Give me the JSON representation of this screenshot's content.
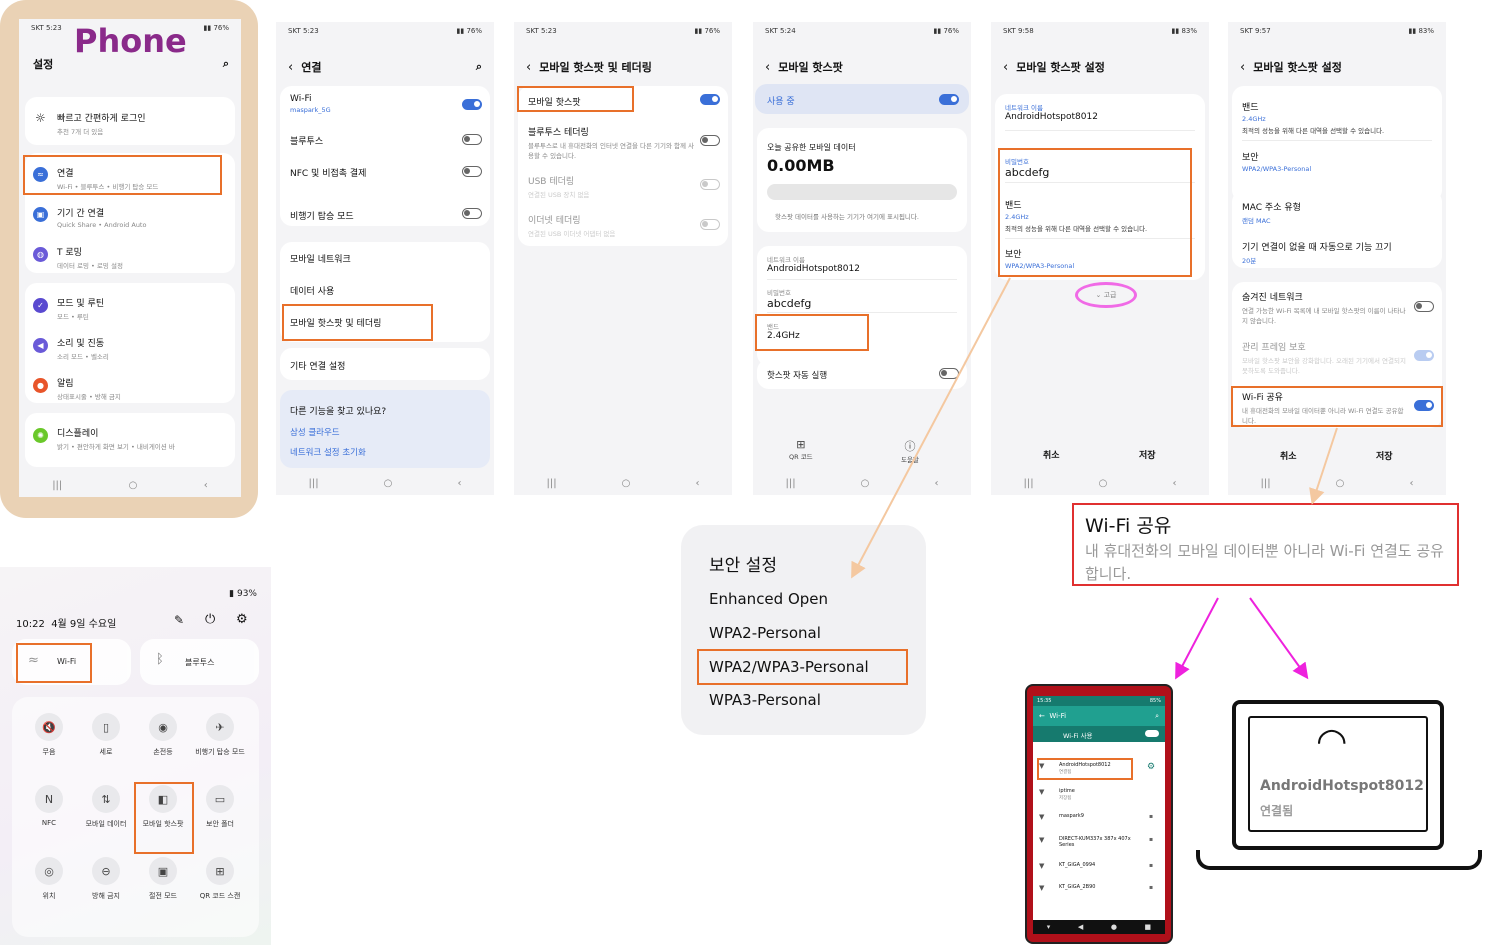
{
  "phone_label": "Phone",
  "s1": {
    "status": "SKT 5:23",
    "battery": "76%",
    "title": "설정",
    "items": [
      {
        "t": "빠르고 간편하게 로그인",
        "s": "추천 7개 더 있음"
      },
      {
        "t": "연결",
        "s": "Wi-Fi • 블루투스 • 비행기 탑승 모드"
      },
      {
        "t": "기기 간 연결",
        "s": "Quick Share • Android Auto"
      },
      {
        "t": "T 로밍",
        "s": "데이터 로밍 • 로밍 설정"
      },
      {
        "t": "모드 및 루틴",
        "s": "모드 • 루틴"
      },
      {
        "t": "소리 및 진동",
        "s": "소리 모드 • 벨소리"
      },
      {
        "t": "알림",
        "s": "상태표시줄 • 방해 금지"
      },
      {
        "t": "디스플레이",
        "s": "밝기 • 편안하게 화면 보기 • 내비게이션 바"
      }
    ]
  },
  "s2": {
    "status": "SKT 5:23",
    "battery": "76%",
    "title": "연결",
    "wifi": "Wi-Fi",
    "wifi_sub": "maspark_5G",
    "bt": "블루투스",
    "nfc": "NFC 및 비접촉 결제",
    "air": "비행기 탑승 모드",
    "mobile_net": "모바일 네트워크",
    "data": "데이터 사용",
    "hotspot": "모바일 핫스팟 및 테더링",
    "other": "기타 연결 설정",
    "looking": "다른 기능을 찾고 있나요?",
    "cloud": "삼성 클라우드",
    "reset": "네트워크 설정 초기화"
  },
  "s3": {
    "status": "SKT 5:23",
    "battery": "76%",
    "title": "모바일 핫스팟 및 테더링",
    "mh": "모바일 핫스팟",
    "bt": "블루투스 테더링",
    "bt_sub": "블루투스로 내 휴대전화의 인터넷 연결을 다른 기기와 함께 사용할 수 있습니다.",
    "usb": "USB 테더링",
    "usb_sub": "연결된 USB 장치 없음",
    "eth": "이더넷 테더링",
    "eth_sub": "연결된 USB 이더넷 어댑터 없음"
  },
  "s4": {
    "status": "SKT 5:24",
    "battery": "76%",
    "title": "모바일 핫스팟",
    "in_use": "사용 중",
    "today": "오늘 공유한 모바일 데이터",
    "mb": "0.00MB",
    "note": "핫스팟 데이터를 사용하는 기기가 여기에 표시됩니다.",
    "name_l": "네트워크 이름",
    "name": "AndroidHotspot8012",
    "pw_l": "비밀번호",
    "pw": "abcdefg",
    "band_l": "밴드",
    "band": "2.4GHz",
    "auto": "핫스팟 자동 실행",
    "qr": "QR 코드",
    "help": "도움말"
  },
  "s5": {
    "status": "SKT 9:58",
    "battery": "83%",
    "title": "모바일 핫스팟 설정",
    "name_l": "네트워크 이름",
    "name": "AndroidHotspot8012",
    "pw_l": "비밀번호",
    "pw": "abcdefg",
    "band_l": "밴드",
    "band": "2.4GHz",
    "band_s": "최적의 성능을 위해 다른 대역을 선택할 수 있습니다.",
    "sec_l": "보안",
    "sec": "WPA2/WPA3-Personal",
    "adv": "고급",
    "cancel": "취소",
    "save": "저장"
  },
  "s6": {
    "status": "SKT 9:57",
    "battery": "83%",
    "title": "모바일 핫스팟 설정",
    "band_l": "밴드",
    "band": "2.4GHz",
    "band_s": "최적의 성능을 위해 다른 대역을 선택할 수 있습니다.",
    "sec_l": "보안",
    "sec": "WPA2/WPA3-Personal",
    "mac_l": "MAC 주소 유형",
    "mac": "랜덤 MAC",
    "off_l": "기기 연결이 없을 때 자동으로 기능 끄기",
    "off": "20분",
    "hidden": "숨겨진 네트워크",
    "hidden_s": "연결 가능한 Wi-Fi 목록에 내 모바일 핫스팟의 이름이 나타나지 않습니다.",
    "pmf": "관리 프레임 보호",
    "pmf_s": "모바일 핫스팟 보안을 강화합니다. 오래된 기기에서 연결되지 못하도록 도와줍니다.",
    "share": "Wi-Fi 공유",
    "share_s": "내 휴대전화의 모바일 데이터뿐 아니라 Wi-Fi 연결도 공유합니다.",
    "cancel": "취소",
    "save": "저장"
  },
  "qp": {
    "battery": "93%",
    "clock": "10:22",
    "date": "4월 9일 수요일",
    "wifi": "Wi-Fi",
    "bt": "블루투스",
    "tiles": [
      "무음",
      "세로",
      "손전등",
      "비행기 탑승 모드",
      "NFC",
      "모바일 데이터",
      "모바일 핫스팟",
      "보안 폴더",
      "위치",
      "방해 금지",
      "절전 모드",
      "QR 코드 스캔"
    ]
  },
  "security": {
    "title": "보안 설정",
    "options": [
      "Enhanced Open",
      "WPA2-Personal",
      "WPA2/WPA3-Personal",
      "WPA3-Personal"
    ]
  },
  "callout": {
    "title": "Wi-Fi 공유",
    "desc": "내 휴대전화의 모바일 데이터뿐 아니라 Wi-Fi 연결도 공유합니다."
  },
  "client": {
    "status": "15:35",
    "battery": "85%",
    "title": "Wi-Fi",
    "use": "Wi-Fi 사용",
    "nets": [
      {
        "n": "AndroidHotspot8012",
        "s": "연결됨"
      },
      {
        "n": "iptime",
        "s": "저장됨"
      },
      {
        "n": "maspark9",
        "s": ""
      },
      {
        "n": "DIRECT-KUM337x 387x 407x Series",
        "s": ""
      },
      {
        "n": "KT_GiGA_0994",
        "s": ""
      },
      {
        "n": "KT_GiGA_2B90",
        "s": ""
      }
    ]
  },
  "laptop": {
    "name": "AndroidHotspot8012",
    "status": "연결됨"
  },
  "colors": {
    "accent": "#3a6fd8",
    "highlight": "#e8702a",
    "arrow_pink": "#ee22dd",
    "arrow_orange": "#f4c8a0"
  }
}
